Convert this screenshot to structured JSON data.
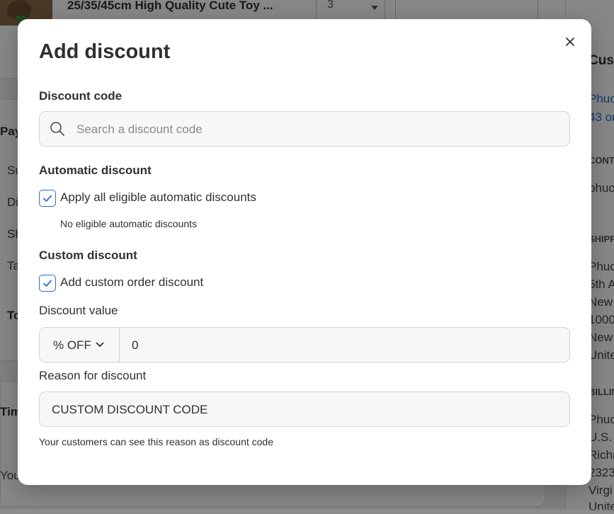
{
  "background": {
    "product_title": "25/35/45cm High Quality Cute Toy ...",
    "quantity": "3",
    "payment_title": "Pay",
    "payment_rows": [
      "Su",
      "Di",
      "Sh",
      "Ta"
    ],
    "total_label": "To",
    "timeline_title": "Tim",
    "timeline_text": "You",
    "sidebar": {
      "customer_title": "Cust",
      "customer_name": "Phuo",
      "customer_orders": "43 or",
      "contact_caption": "CONT",
      "contact_email": "phuo",
      "shipping_caption": "SHIPP",
      "shipping_lines": [
        "Phuo",
        "5th A",
        "New",
        "1000",
        "New",
        "Unite"
      ],
      "billing_caption": "BILLIN",
      "billing_lines": [
        "Phuo",
        "U.S. F",
        "Richm",
        "2323",
        "Virgi",
        "Unite"
      ]
    }
  },
  "modal": {
    "title": "Add discount",
    "close_icon": "close-icon",
    "discount_code": {
      "label": "Discount code",
      "placeholder": "Search a discount code",
      "value": ""
    },
    "automatic": {
      "label": "Automatic discount",
      "checkbox_label": "Apply all eligible automatic discounts",
      "checked": true,
      "hint": "No eligible automatic discounts"
    },
    "custom": {
      "label": "Custom discount",
      "checkbox_label": "Add custom order discount",
      "checked": true,
      "value_label": "Discount value",
      "unit": "% OFF",
      "value": "0",
      "reason_label": "Reason for discount",
      "reason_value": "CUSTOM DISCOUNT CODE",
      "reason_hint": "Your customers can see this reason as discount code"
    },
    "colors": {
      "accent": "#2c6ecb",
      "text": "#303030"
    }
  }
}
